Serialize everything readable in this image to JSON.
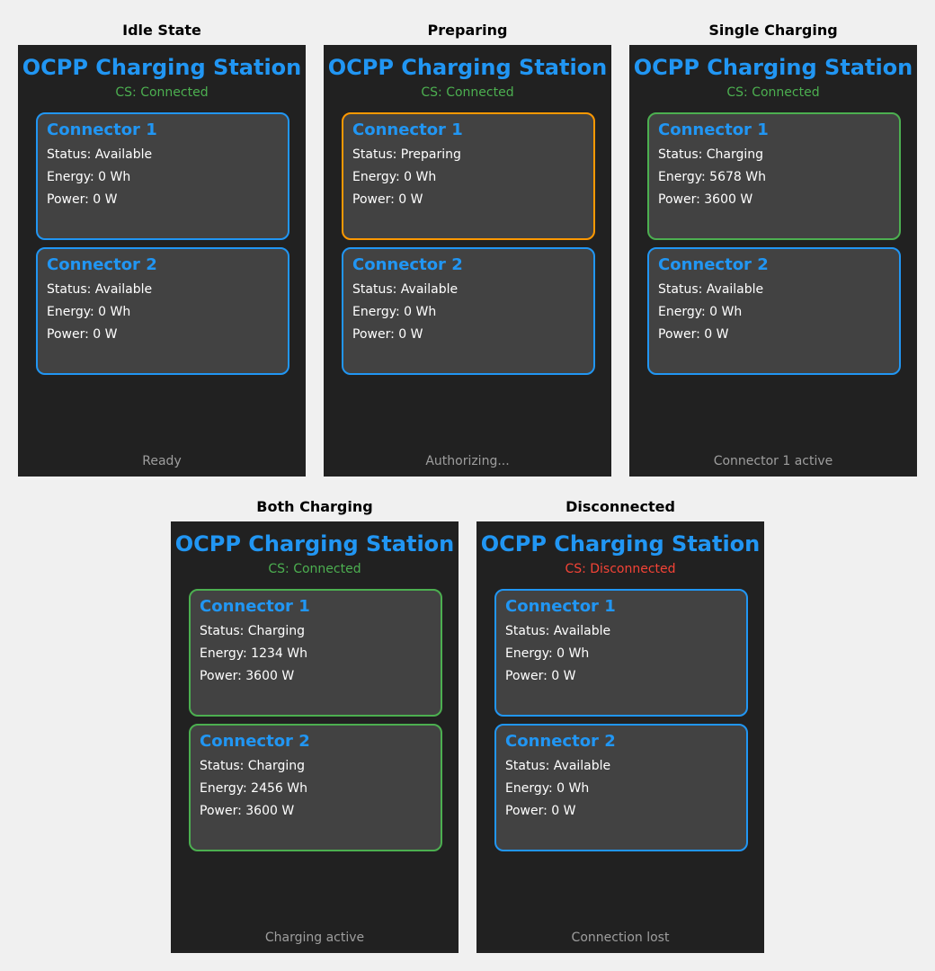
{
  "station_title": "OCPP Charging Station",
  "palette": {
    "available": "#2196f3",
    "preparing": "#ff9800",
    "charging": "#4caf50",
    "connected": "#4caf50",
    "disconnected": "#f44336"
  },
  "panels": [
    {
      "caption": "Idle State",
      "cs_status": "CS: Connected",
      "cs_state": "connected",
      "footer": "Ready",
      "connectors": [
        {
          "name": "Connector 1",
          "status": "Status: Available",
          "energy": "Energy: 0 Wh",
          "power": "Power: 0 W",
          "state": "available"
        },
        {
          "name": "Connector 2",
          "status": "Status: Available",
          "energy": "Energy: 0 Wh",
          "power": "Power: 0 W",
          "state": "available"
        }
      ]
    },
    {
      "caption": "Preparing",
      "cs_status": "CS: Connected",
      "cs_state": "connected",
      "footer": "Authorizing...",
      "connectors": [
        {
          "name": "Connector 1",
          "status": "Status: Preparing",
          "energy": "Energy: 0 Wh",
          "power": "Power: 0 W",
          "state": "preparing"
        },
        {
          "name": "Connector 2",
          "status": "Status: Available",
          "energy": "Energy: 0 Wh",
          "power": "Power: 0 W",
          "state": "available"
        }
      ]
    },
    {
      "caption": "Single Charging",
      "cs_status": "CS: Connected",
      "cs_state": "connected",
      "footer": "Connector 1 active",
      "connectors": [
        {
          "name": "Connector 1",
          "status": "Status: Charging",
          "energy": "Energy: 5678 Wh",
          "power": "Power: 3600 W",
          "state": "charging"
        },
        {
          "name": "Connector 2",
          "status": "Status: Available",
          "energy": "Energy: 0 Wh",
          "power": "Power: 0 W",
          "state": "available"
        }
      ]
    },
    {
      "caption": "Both Charging",
      "cs_status": "CS: Connected",
      "cs_state": "connected",
      "footer": "Charging active",
      "connectors": [
        {
          "name": "Connector 1",
          "status": "Status: Charging",
          "energy": "Energy: 1234 Wh",
          "power": "Power: 3600 W",
          "state": "charging"
        },
        {
          "name": "Connector 2",
          "status": "Status: Charging",
          "energy": "Energy: 2456 Wh",
          "power": "Power: 3600 W",
          "state": "charging"
        }
      ]
    },
    {
      "caption": "Disconnected",
      "cs_status": "CS: Disconnected",
      "cs_state": "disconnected",
      "footer": "Connection lost",
      "connectors": [
        {
          "name": "Connector 1",
          "status": "Status: Available",
          "energy": "Energy: 0 Wh",
          "power": "Power: 0 W",
          "state": "available"
        },
        {
          "name": "Connector 2",
          "status": "Status: Available",
          "energy": "Energy: 0 Wh",
          "power": "Power: 0 W",
          "state": "available"
        }
      ]
    }
  ]
}
